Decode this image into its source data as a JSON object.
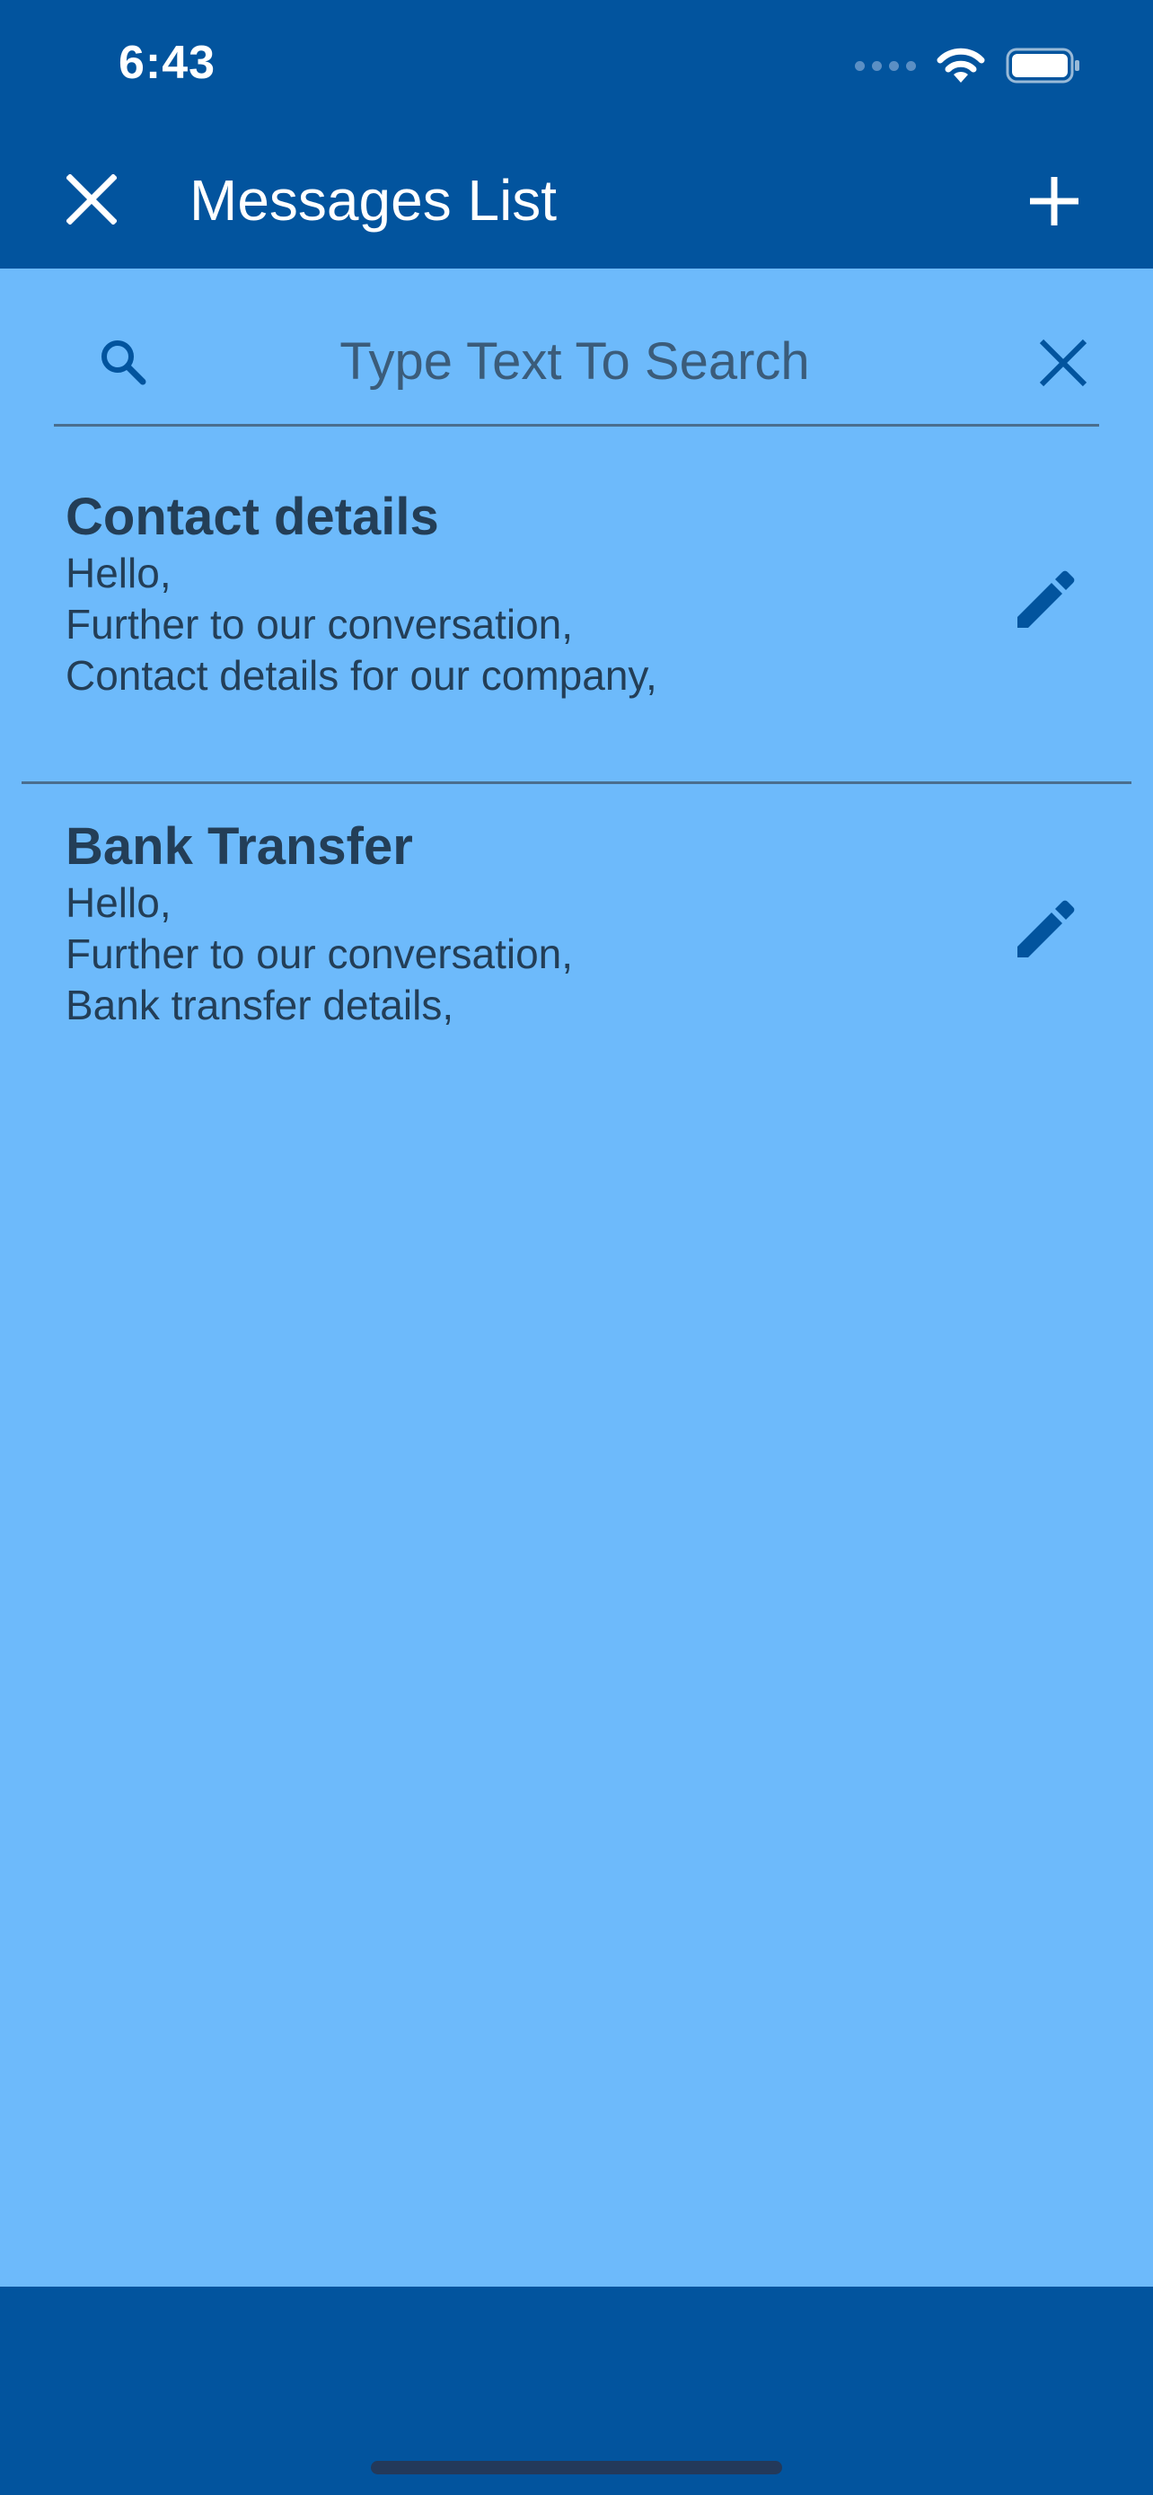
{
  "status_bar": {
    "time": "6:43",
    "icons": [
      "signal-dots-icon",
      "wifi-icon",
      "battery-icon"
    ]
  },
  "app_bar": {
    "title": "Messages List",
    "close_icon": "close-icon",
    "add_icon": "plus-icon"
  },
  "search": {
    "placeholder": "Type Text To Search",
    "value": "",
    "icon": "search-icon",
    "clear_icon": "close-icon"
  },
  "messages": [
    {
      "title": "Contact details",
      "body": "Hello,\nFurther to our conversation,\nContact details for our company,",
      "action_icon": "pencil-icon"
    },
    {
      "title": "Bank Transfer",
      "body": "Hello,\nFurther to our conversation,\nBank transfer details,",
      "action_icon": "pencil-icon"
    }
  ],
  "colors": {
    "primary": "#02549e",
    "background": "#6dbafb",
    "text": "#233e57",
    "icon": "#02549e"
  }
}
